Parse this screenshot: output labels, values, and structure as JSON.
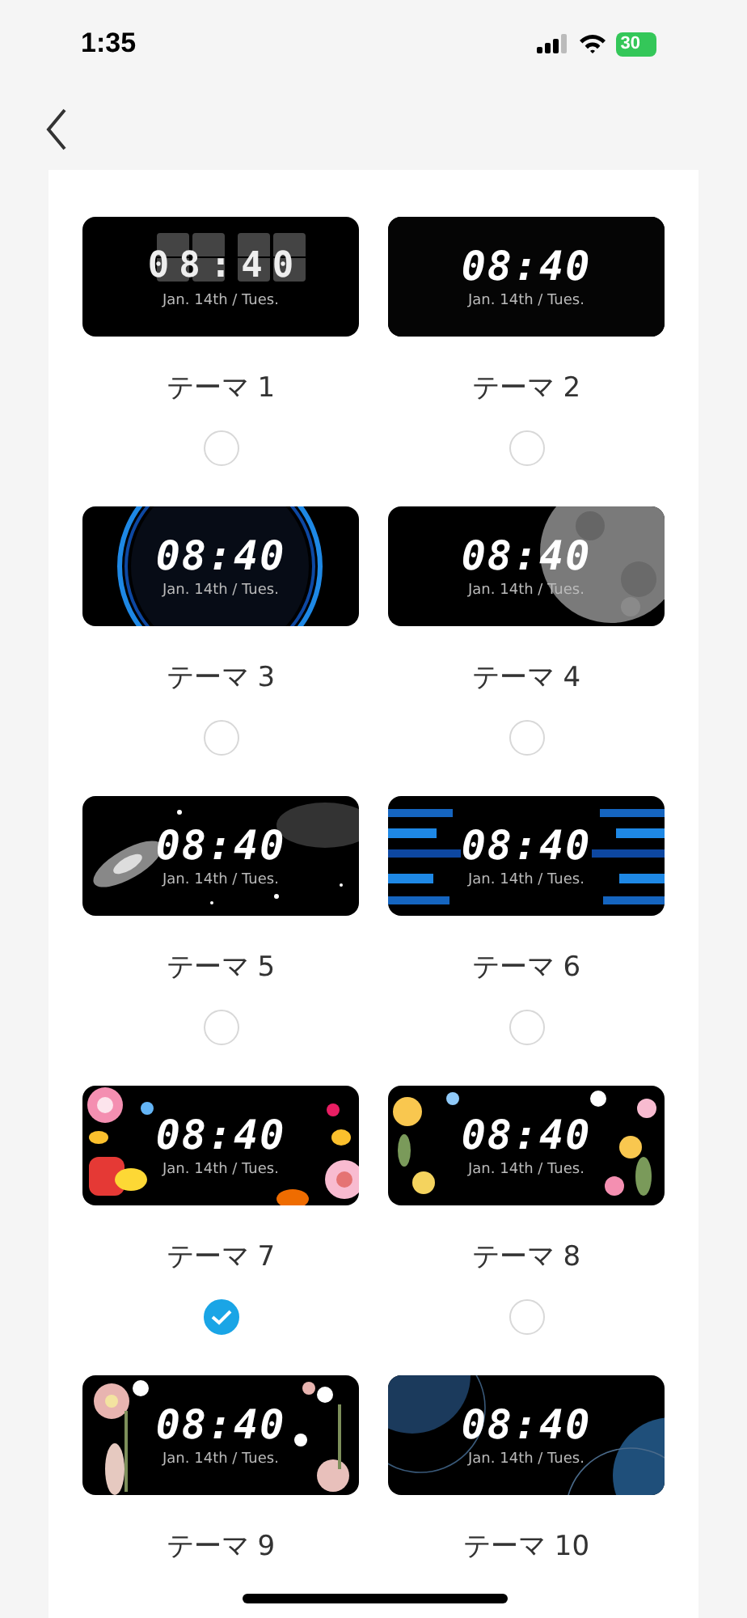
{
  "status_bar": {
    "time": "1:35",
    "battery": "30"
  },
  "themes": [
    {
      "label": "テーマ 1",
      "kind": "flip",
      "time": "08:40",
      "date": "Jan. 14th / Tues.",
      "selected": false
    },
    {
      "label": "テーマ 2",
      "kind": "plain",
      "time": "08:40",
      "date": "Jan. 14th / Tues.",
      "selected": false
    },
    {
      "label": "テーマ 3",
      "kind": "ring",
      "time": "08:40",
      "date": "Jan. 14th / Tues.",
      "selected": false
    },
    {
      "label": "テーマ 4",
      "kind": "moon",
      "time": "08:40",
      "date": "Jan. 14th / Tues.",
      "selected": false
    },
    {
      "label": "テーマ 5",
      "kind": "galaxy",
      "time": "08:40",
      "date": "Jan. 14th / Tues.",
      "selected": false
    },
    {
      "label": "テーマ 6",
      "kind": "stripes",
      "time": "08:40",
      "date": "Jan. 14th / Tues.",
      "selected": false
    },
    {
      "label": "テーマ 7",
      "kind": "candy",
      "time": "08:40",
      "date": "Jan. 14th / Tues.",
      "selected": true
    },
    {
      "label": "テーマ 8",
      "kind": "flowers",
      "time": "08:40",
      "date": "Jan. 14th / Tues.",
      "selected": false
    },
    {
      "label": "テーマ 9",
      "kind": "blossoms",
      "time": "08:40",
      "date": "Jan. 14th / Tues."
    },
    {
      "label": "テーマ 10",
      "kind": "waves",
      "time": "08:40",
      "date": "Jan. 14th / Tues."
    }
  ]
}
